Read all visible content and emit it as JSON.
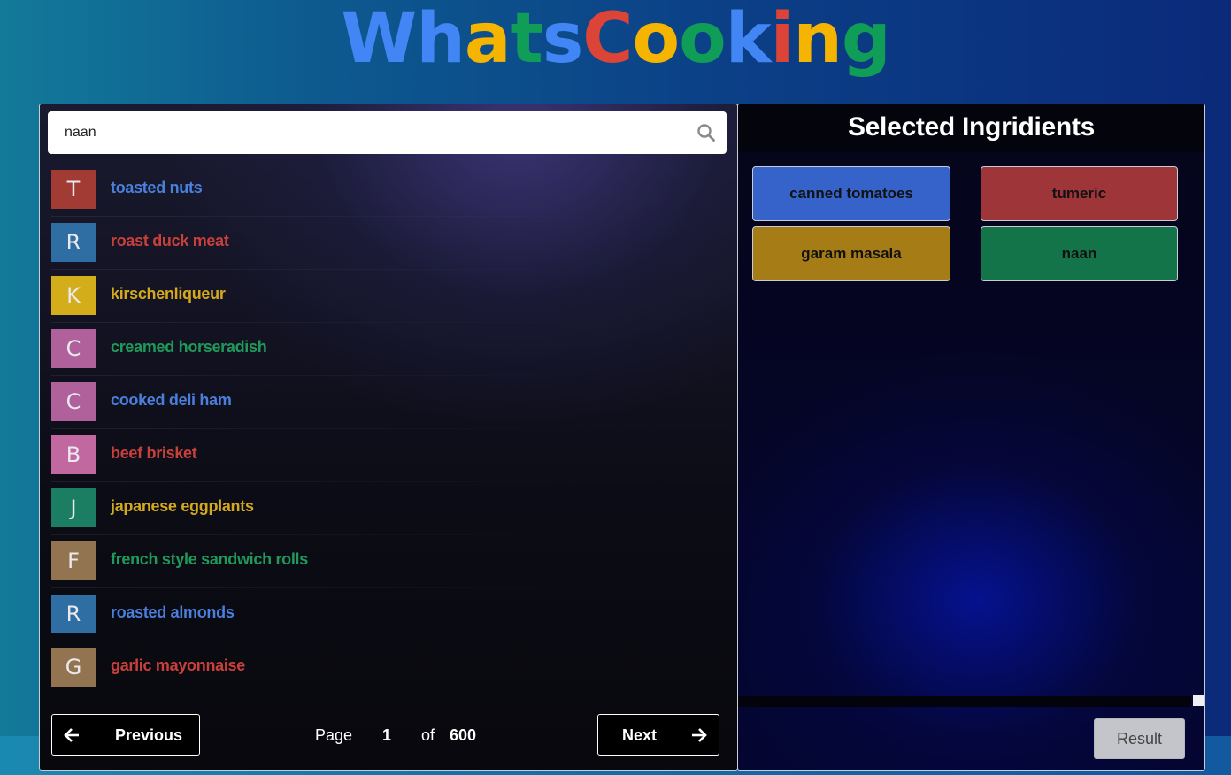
{
  "logo": {
    "letters": [
      {
        "ch": "W",
        "color": "#4285F4"
      },
      {
        "ch": "h",
        "color": "#4285F4"
      },
      {
        "ch": "a",
        "color": "#F4B400"
      },
      {
        "ch": "t",
        "color": "#0F9D58"
      },
      {
        "ch": "s",
        "color": "#4285F4"
      },
      {
        "ch": "C",
        "color": "#DB4437"
      },
      {
        "ch": "o",
        "color": "#F4B400"
      },
      {
        "ch": "o",
        "color": "#0F9D58"
      },
      {
        "ch": "k",
        "color": "#4285F4"
      },
      {
        "ch": "i",
        "color": "#DB4437"
      },
      {
        "ch": "n",
        "color": "#F4B400"
      },
      {
        "ch": "g",
        "color": "#0F9D58"
      }
    ]
  },
  "search": {
    "value": "naan",
    "icon": "search-icon"
  },
  "ingredients": [
    {
      "initial": "T",
      "label": "toasted nuts",
      "avatar_color": "#a23b34",
      "text_color": "#4a7fdc"
    },
    {
      "initial": "R",
      "label": "roast duck meat",
      "avatar_color": "#2e6ea3",
      "text_color": "#c9403b"
    },
    {
      "initial": "K",
      "label": "kirschenliqueur",
      "avatar_color": "#d4ad1a",
      "text_color": "#d4a91c"
    },
    {
      "initial": "C",
      "label": "creamed horseradish",
      "avatar_color": "#b0609a",
      "text_color": "#1f9a5a"
    },
    {
      "initial": "C",
      "label": "cooked deli ham",
      "avatar_color": "#b0609a",
      "text_color": "#4a7fdc"
    },
    {
      "initial": "B",
      "label": "beef brisket",
      "avatar_color": "#c268a0",
      "text_color": "#c9403b"
    },
    {
      "initial": "J",
      "label": "japanese eggplants",
      "avatar_color": "#1b7d62",
      "text_color": "#d4a91c"
    },
    {
      "initial": "F",
      "label": "french style sandwich rolls",
      "avatar_color": "#927550",
      "text_color": "#1f9a5a"
    },
    {
      "initial": "R",
      "label": "roasted almonds",
      "avatar_color": "#2e6ea3",
      "text_color": "#4a7fdc"
    },
    {
      "initial": "G",
      "label": "garlic mayonnaise",
      "avatar_color": "#927550",
      "text_color": "#c9403b"
    }
  ],
  "pager": {
    "previous_label": "Previous",
    "next_label": "Next",
    "page_word": "Page",
    "current_page": "1",
    "of_word": "of",
    "total_pages": "600"
  },
  "selected": {
    "title": "Selected Ingridients",
    "chips": [
      {
        "label": "canned tomatoes",
        "color": "#3563c9"
      },
      {
        "label": "tumeric",
        "color": "#9e3539"
      },
      {
        "label": "garam masala",
        "color": "#a67c17"
      },
      {
        "label": "naan",
        "color": "#137349"
      }
    ],
    "result_label": "Result"
  }
}
